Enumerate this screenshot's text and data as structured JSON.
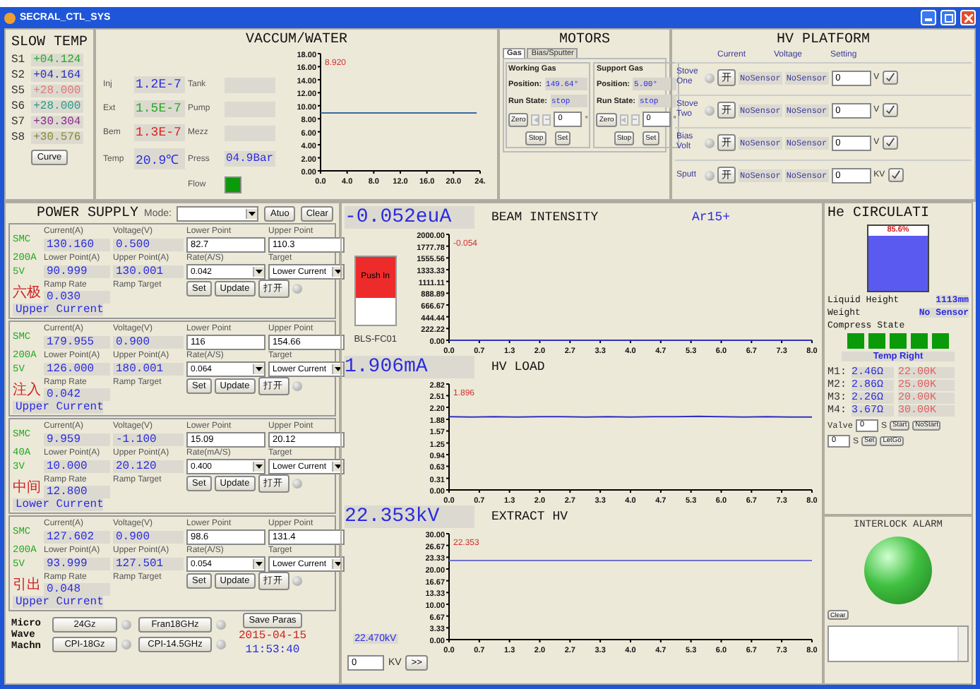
{
  "window": {
    "title": "SECRAL_CTL_SYS"
  },
  "slow_temp": {
    "title": "SLOW TEMP",
    "sensors": [
      {
        "name": "S1",
        "value": "+04.124",
        "color": "#22aa22"
      },
      {
        "name": "S2",
        "value": "+04.164",
        "color": "#2a2ac0"
      },
      {
        "name": "S5",
        "value": "+28.000",
        "color": "#e07878"
      },
      {
        "name": "S6",
        "value": "+28.000",
        "color": "#2a9a8a"
      },
      {
        "name": "S7",
        "value": "+30.304",
        "color": "#8a2a8a"
      },
      {
        "name": "S8",
        "value": "+30.576",
        "color": "#8a8a30"
      }
    ],
    "button": "Curve"
  },
  "vacuum": {
    "title": "VACCUM/WATER",
    "readings": [
      {
        "label": "Inj",
        "value": "1.2E-7",
        "color": "#2a2ae0"
      },
      {
        "label": "Ext",
        "value": "1.5E-7",
        "color": "#22aa22"
      },
      {
        "label": "Bem",
        "value": "1.3E-7",
        "color": "#e02020"
      },
      {
        "label": "Temp",
        "value": "20.9℃",
        "color": "#2a2ae0"
      }
    ],
    "gauges": [
      {
        "label": "Tank"
      },
      {
        "label": "Pump"
      },
      {
        "label": "Mezz"
      },
      {
        "label": "Press",
        "value": "04.9Bar"
      }
    ],
    "flow": {
      "label": "Flow",
      "on": true
    },
    "chart_data": {
      "type": "line",
      "x": [
        0,
        23.5
      ],
      "series": [
        {
          "color": "#3a6aa0",
          "values": [
            8.9,
            8.9
          ]
        }
      ],
      "xlim": [
        0,
        24
      ],
      "ylim": [
        0,
        18
      ],
      "xticks": [
        {
          "value": 0,
          "label": "0.0"
        },
        {
          "value": 4,
          "label": "4.0"
        },
        {
          "value": 8,
          "label": "8.0"
        },
        {
          "value": 12,
          "label": "12.0"
        },
        {
          "value": 16,
          "label": "16.0"
        },
        {
          "value": 20,
          "label": "20.0"
        },
        {
          "value": 24,
          "label": "24."
        }
      ],
      "yticks": [
        {
          "value": 0,
          "label": "0.00"
        },
        {
          "value": 2,
          "label": "2.00"
        },
        {
          "value": 4,
          "label": "4.00"
        },
        {
          "value": 6,
          "label": "6.00"
        },
        {
          "value": 8,
          "label": "8.00"
        },
        {
          "value": 10,
          "label": "10.00"
        },
        {
          "value": 12,
          "label": "12.00"
        },
        {
          "value": 14,
          "label": "14.00"
        },
        {
          "value": 16,
          "label": "16.00"
        },
        {
          "value": 18,
          "label": "18.00"
        }
      ],
      "annotations": [
        "8.920"
      ]
    }
  },
  "motors": {
    "title": "MOTORS",
    "tabs": [
      {
        "label": "Gas",
        "selected": true
      },
      {
        "label": "Bias/Sputter",
        "selected": false
      }
    ],
    "groups": [
      {
        "title": "Working Gas",
        "position_label": "Position:",
        "position": "149.64°",
        "state_label": "Run State:",
        "state": "stop",
        "zero": "Zero",
        "input": "0",
        "unit": "°",
        "buttons": [
          "Stop",
          "Set"
        ]
      },
      {
        "title": "Support Gas",
        "position_label": "Position:",
        "position": "5.00°",
        "state_label": "Run State:",
        "state": "stop",
        "zero": "Zero",
        "input": "0",
        "unit": "°",
        "buttons": [
          "Stop",
          "Set"
        ]
      }
    ]
  },
  "hv_platform": {
    "title": "HV PLATFORM",
    "columns": [
      "Current",
      "Voltage",
      "Setting"
    ],
    "rows": [
      {
        "label": "Stove One",
        "on": false,
        "switch": "开",
        "current": "NoSensor",
        "voltage": "NoSensor",
        "setting": "0",
        "unit": "V"
      },
      {
        "label": "Stove Two",
        "on": false,
        "switch": "开",
        "current": "NoSensor",
        "voltage": "NoSensor",
        "setting": "0",
        "unit": "V"
      },
      {
        "label": "Bias Volt",
        "on": false,
        "switch": "开",
        "current": "NoSensor",
        "voltage": "NoSensor",
        "setting": "0",
        "unit": "V"
      },
      {
        "label": "Sputt",
        "on": false,
        "switch": "开",
        "current": "NoSensor",
        "voltage": "NoSensor",
        "setting": "0",
        "unit": "KV"
      }
    ]
  },
  "power_supply": {
    "title": "POWER SUPPLY",
    "mode_label": "Mode:",
    "buttons": [
      "Atuo",
      "Clear"
    ],
    "units": [
      {
        "tags": [
          "SMC",
          "200A",
          "5V"
        ],
        "name": "六极",
        "current_label": "Current(A)",
        "current": "130.160",
        "voltage_label": "Voltage(V)",
        "voltage": "0.500",
        "lower_label": "Lower Point",
        "lower": "82.7",
        "upper_label": "Upper Point",
        "upper": "110.3",
        "lower_a_label": "Lower Point(A)",
        "lower_a": "90.999",
        "upper_a_label": "Upper Point(A)",
        "upper_a": "130.001",
        "rate_label": "Rate(A/S)",
        "rate": "0.042",
        "target_label": "Target",
        "target": "Lower Current",
        "ramp_rate_label": "Ramp Rate",
        "ramp_rate": "0.030",
        "ramp_target_label": "Ramp Target",
        "ramp_target": "Upper Current",
        "buttons": [
          "Set",
          "Update",
          "打开"
        ],
        "on": false
      },
      {
        "tags": [
          "SMC",
          "200A",
          "5V"
        ],
        "name": "注入",
        "current_label": "Current(A)",
        "current": "179.955",
        "voltage_label": "Voltage(V)",
        "voltage": "0.900",
        "lower_label": "Lower Point",
        "lower": "116",
        "upper_label": "Upper Point",
        "upper": "154.66",
        "lower_a_label": "Lower Point(A)",
        "lower_a": "126.000",
        "upper_a_label": "Upper Point(A)",
        "upper_a": "180.001",
        "rate_label": "Rate(A/S)",
        "rate": "0.064",
        "target_label": "Target",
        "target": "Lower Current",
        "ramp_rate_label": "Ramp Rate",
        "ramp_rate": "0.042",
        "ramp_target_label": "Ramp Target",
        "ramp_target": "Upper Current",
        "buttons": [
          "Set",
          "Update",
          "打开"
        ],
        "on": false
      },
      {
        "tags": [
          "SMC",
          "40A",
          "3V"
        ],
        "name": "中间",
        "current_label": "Current(A)",
        "current": "9.959",
        "voltage_label": "Voltage(V)",
        "voltage": "-1.100",
        "lower_label": "Lower Point",
        "lower": "15.09",
        "upper_label": "Upper Point",
        "upper": "20.12",
        "lower_a_label": "Lower Point(A)",
        "lower_a": "10.000",
        "upper_a_label": "Upper Point(A)",
        "upper_a": "20.120",
        "rate_label": "Rate(mA/S)",
        "rate": "0.400",
        "target_label": "Target",
        "target": "Lower Current",
        "ramp_rate_label": "Ramp Rate",
        "ramp_rate": "12.800",
        "ramp_target_label": "Ramp Target",
        "ramp_target": "Lower Current",
        "buttons": [
          "Set",
          "Update",
          "打开"
        ],
        "on": false
      },
      {
        "tags": [
          "SMC",
          "200A",
          "5V"
        ],
        "name": "引出",
        "current_label": "Current(A)",
        "current": "127.602",
        "voltage_label": "Voltage(V)",
        "voltage": "0.900",
        "lower_label": "Lower Point",
        "lower": "98.6",
        "upper_label": "Upper Point",
        "upper": "131.4",
        "lower_a_label": "Lower Point(A)",
        "lower_a": "93.999",
        "upper_a_label": "Upper Point(A)",
        "upper_a": "127.501",
        "rate_label": "Rate(A/S)",
        "rate": "0.054",
        "target_label": "Target",
        "target": "Lower Current",
        "ramp_rate_label": "Ramp Rate",
        "ramp_rate": "0.048",
        "ramp_target_label": "Ramp Target",
        "ramp_target": "Upper Current",
        "buttons": [
          "Set",
          "Update",
          "打开"
        ],
        "on": false
      }
    ]
  },
  "microwave": {
    "label": "Micro Wave Machn",
    "sources": [
      {
        "label": "24Gz",
        "on": false
      },
      {
        "label": "Fran18GHz",
        "on": false
      },
      {
        "label": "CPI-18Gz",
        "on": false
      },
      {
        "label": "CPI-14.5GHz",
        "on": false
      }
    ],
    "save": "Save Paras",
    "date": "2015-04-15",
    "time": "11:53:40"
  },
  "beam": {
    "reading": "-0.052euA",
    "title": "BEAM INTENSITY",
    "ion": "Ar15+",
    "push_button": {
      "label": "Push In",
      "pushed": true
    },
    "device": "BLS-FC01",
    "chart_data": {
      "type": "line",
      "x": [
        0,
        8
      ],
      "series": [
        {
          "color": "#3030c0",
          "values": [
            0,
            0
          ]
        }
      ],
      "xlim": [
        0,
        8
      ],
      "ylim": [
        0,
        2000
      ],
      "xticks": [
        {
          "value": 0,
          "label": "0.0"
        },
        {
          "value": 0.667,
          "label": "0.7"
        },
        {
          "value": 1.333,
          "label": "1.3"
        },
        {
          "value": 2,
          "label": "2.0"
        },
        {
          "value": 2.667,
          "label": "2.7"
        },
        {
          "value": 3.333,
          "label": "3.3"
        },
        {
          "value": 4,
          "label": "4.0"
        },
        {
          "value": 4.667,
          "label": "4.7"
        },
        {
          "value": 5.333,
          "label": "5.3"
        },
        {
          "value": 6,
          "label": "6.0"
        },
        {
          "value": 6.667,
          "label": "6.7"
        },
        {
          "value": 7.333,
          "label": "7.3"
        },
        {
          "value": 8,
          "label": "8.0"
        }
      ],
      "yticks": [
        {
          "value": 0,
          "label": "0.00"
        },
        {
          "value": 222.22,
          "label": "222.22"
        },
        {
          "value": 444.44,
          "label": "444.44"
        },
        {
          "value": 666.67,
          "label": "666.67"
        },
        {
          "value": 888.89,
          "label": "888.89"
        },
        {
          "value": 1111.11,
          "label": "1111.11"
        },
        {
          "value": 1333.33,
          "label": "1333.33"
        },
        {
          "value": 1555.56,
          "label": "1555.56"
        },
        {
          "value": 1777.78,
          "label": "1777.78"
        },
        {
          "value": 2000,
          "label": "2000.00"
        }
      ],
      "annotations": [
        "-0.054"
      ]
    }
  },
  "hv_load": {
    "reading": "1.906mA",
    "title": "HV LOAD",
    "chart_data": {
      "type": "line",
      "x": [
        0,
        0.5,
        1,
        1.5,
        2,
        2.5,
        3,
        3.5,
        4,
        4.5,
        5,
        5.5,
        6,
        6.5,
        7,
        7.5,
        8
      ],
      "series": [
        {
          "color": "#3030c0",
          "values": [
            1.95,
            1.94,
            1.95,
            1.94,
            1.95,
            1.95,
            1.94,
            1.95,
            1.94,
            1.95,
            1.95,
            1.96,
            1.95,
            1.94,
            1.95,
            1.94,
            1.94
          ]
        }
      ],
      "xlim": [
        0,
        8
      ],
      "ylim": [
        0,
        2.82
      ],
      "xticks": [
        {
          "value": 0,
          "label": "0.0"
        },
        {
          "value": 0.667,
          "label": "0.7"
        },
        {
          "value": 1.333,
          "label": "1.3"
        },
        {
          "value": 2,
          "label": "2.0"
        },
        {
          "value": 2.667,
          "label": "2.7"
        },
        {
          "value": 3.333,
          "label": "3.3"
        },
        {
          "value": 4,
          "label": "4.0"
        },
        {
          "value": 4.667,
          "label": "4.7"
        },
        {
          "value": 5.333,
          "label": "5.3"
        },
        {
          "value": 6,
          "label": "6.0"
        },
        {
          "value": 6.667,
          "label": "6.7"
        },
        {
          "value": 7.333,
          "label": "7.3"
        },
        {
          "value": 8,
          "label": "8.0"
        }
      ],
      "yticks": [
        {
          "value": 0,
          "label": "0.00"
        },
        {
          "value": 0.31,
          "label": "0.31"
        },
        {
          "value": 0.63,
          "label": "0.63"
        },
        {
          "value": 0.94,
          "label": "0.94"
        },
        {
          "value": 1.25,
          "label": "1.25"
        },
        {
          "value": 1.57,
          "label": "1.57"
        },
        {
          "value": 1.88,
          "label": "1.88"
        },
        {
          "value": 2.2,
          "label": "2.20"
        },
        {
          "value": 2.51,
          "label": "2.51"
        },
        {
          "value": 2.82,
          "label": "2.82"
        }
      ],
      "annotations": [
        "1.896"
      ]
    }
  },
  "extract": {
    "reading": "22.353kV",
    "title": "EXTRACT HV",
    "side_reading": "22.470kV",
    "input": "0",
    "unit": "KV",
    "button": ">>",
    "chart_data": {
      "type": "line",
      "x": [
        0,
        8
      ],
      "series": [
        {
          "color": "#7070d0",
          "values": [
            22.4,
            22.4
          ]
        }
      ],
      "xlim": [
        0,
        8
      ],
      "ylim": [
        0,
        30
      ],
      "xticks": [
        {
          "value": 0,
          "label": "0.0"
        },
        {
          "value": 0.667,
          "label": "0.7"
        },
        {
          "value": 1.333,
          "label": "1.3"
        },
        {
          "value": 2,
          "label": "2.0"
        },
        {
          "value": 2.667,
          "label": "2.7"
        },
        {
          "value": 3.333,
          "label": "3.3"
        },
        {
          "value": 4,
          "label": "4.0"
        },
        {
          "value": 4.667,
          "label": "4.7"
        },
        {
          "value": 5.333,
          "label": "5.3"
        },
        {
          "value": 6,
          "label": "6.0"
        },
        {
          "value": 6.667,
          "label": "6.7"
        },
        {
          "value": 7.333,
          "label": "7.3"
        },
        {
          "value": 8,
          "label": "8.0"
        }
      ],
      "yticks": [
        {
          "value": 0,
          "label": "0.00"
        },
        {
          "value": 3.33,
          "label": "3.33"
        },
        {
          "value": 6.67,
          "label": "6.67"
        },
        {
          "value": 10,
          "label": "10.00"
        },
        {
          "value": 13.33,
          "label": "13.33"
        },
        {
          "value": 16.67,
          "label": "16.67"
        },
        {
          "value": 20,
          "label": "20.00"
        },
        {
          "value": 23.33,
          "label": "23.33"
        },
        {
          "value": 26.67,
          "label": "26.67"
        },
        {
          "value": 30,
          "label": "30.00"
        }
      ],
      "annotations": [
        "22.353"
      ]
    }
  },
  "he_circulation": {
    "title": "He CIRCULATI",
    "tank": {
      "level": 0.856,
      "label": "85.6%"
    },
    "liquid_label": "Liquid Height",
    "liquid": "1113mm",
    "weight_label": "Weight",
    "weight": "No Sensor",
    "compress_label": "Compress State",
    "compressors": [
      {
        "on": true
      },
      {
        "on": true
      },
      {
        "on": true
      },
      {
        "on": true
      },
      {
        "on": true
      }
    ],
    "status": "Temp Right",
    "sensors": [
      {
        "label": "M1:",
        "resistance": "2.46Ω",
        "temperature": "22.00K"
      },
      {
        "label": "M2:",
        "resistance": "2.86Ω",
        "temperature": "25.00K"
      },
      {
        "label": "M3:",
        "resistance": "2.26Ω",
        "temperature": "20.00K"
      },
      {
        "label": "M4:",
        "resistance": "3.67Ω",
        "temperature": "30.00K"
      }
    ],
    "valve_label": "Valve",
    "valve_input": "0",
    "valve_unit": "S",
    "valve_buttons": [
      "Start",
      "NoStart"
    ],
    "set_input": "0",
    "set_unit": "S",
    "set_buttons": [
      "Set",
      "LetGo"
    ]
  },
  "interlock": {
    "title": "INTERLOCK ALARM",
    "ok": true,
    "button": "Clear"
  }
}
